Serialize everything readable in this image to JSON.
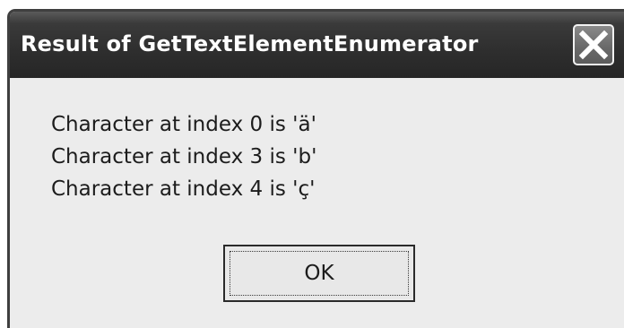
{
  "dialog": {
    "title": "Result of GetTextElementEnumerator",
    "close_icon": "close-icon",
    "messages": [
      "Character at index 0 is 'ä'",
      "Character at index 3 is 'b'",
      "Character at index 4 is 'ç'"
    ],
    "ok_label": "OK"
  }
}
